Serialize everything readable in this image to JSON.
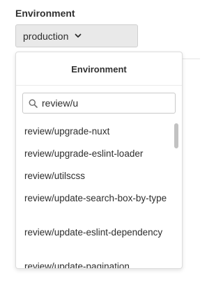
{
  "field": {
    "label": "Environment"
  },
  "toggle": {
    "selected": "production",
    "icon": "chevron-down-icon"
  },
  "menu": {
    "title": "Environment",
    "search": {
      "value": "review/u",
      "placeholder": "",
      "icon": "search-icon"
    },
    "items": [
      {
        "label": "review/upgrade-nuxt"
      },
      {
        "label": "review/upgrade-eslint-loader"
      },
      {
        "label": "review/utilscss"
      },
      {
        "label": "review/update-search-box-by-type"
      },
      {
        "label": "review/update-eslint-dependency"
      },
      {
        "label": "review/update-pagination"
      }
    ]
  },
  "colors": {
    "toggle_bg": "#e9e9e9",
    "border": "#dcdcdc",
    "text": "#2e2e2e",
    "scroll_thumb": "#c2c2c2"
  }
}
